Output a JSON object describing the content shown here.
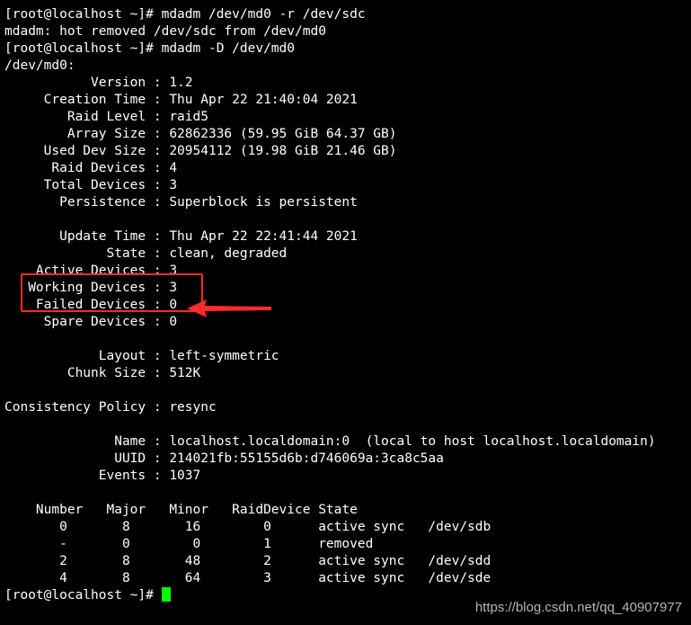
{
  "terminal": {
    "lines": [
      "[root@localhost ~]# mdadm /dev/md0 -r /dev/sdc",
      "mdadm: hot removed /dev/sdc from /dev/md0",
      "[root@localhost ~]# mdadm -D /dev/md0",
      "/dev/md0:",
      "           Version : 1.2",
      "     Creation Time : Thu Apr 22 21:40:04 2021",
      "        Raid Level : raid5",
      "        Array Size : 62862336 (59.95 GiB 64.37 GB)",
      "     Used Dev Size : 20954112 (19.98 GiB 21.46 GB)",
      "      Raid Devices : 4",
      "     Total Devices : 3",
      "       Persistence : Superblock is persistent",
      "",
      "       Update Time : Thu Apr 22 22:41:44 2021",
      "             State : clean, degraded",
      "    Active Devices : 3",
      "   Working Devices : 3",
      "    Failed Devices : 0",
      "     Spare Devices : 0",
      "",
      "            Layout : left-symmetric",
      "        Chunk Size : 512K",
      "",
      "Consistency Policy : resync",
      "",
      "              Name : localhost.localdomain:0  (local to host localhost.localdomain)",
      "              UUID : 214021fb:55155d6b:d746069a:3ca8c5aa",
      "            Events : 1037",
      "",
      "    Number   Major   Minor   RaidDevice State",
      "       0       8       16        0      active sync   /dev/sdb",
      "       -       0        0        1      removed",
      "       2       8       48        2      active sync   /dev/sdd",
      "       4       8       64        3      active sync   /dev/sde"
    ],
    "prompt": "[root@localhost ~]# "
  },
  "annotation": {
    "color": "#ff2a2a"
  },
  "cursor_color": "#00ff00",
  "watermark": "https://blog.csdn.net/qq_40907977"
}
